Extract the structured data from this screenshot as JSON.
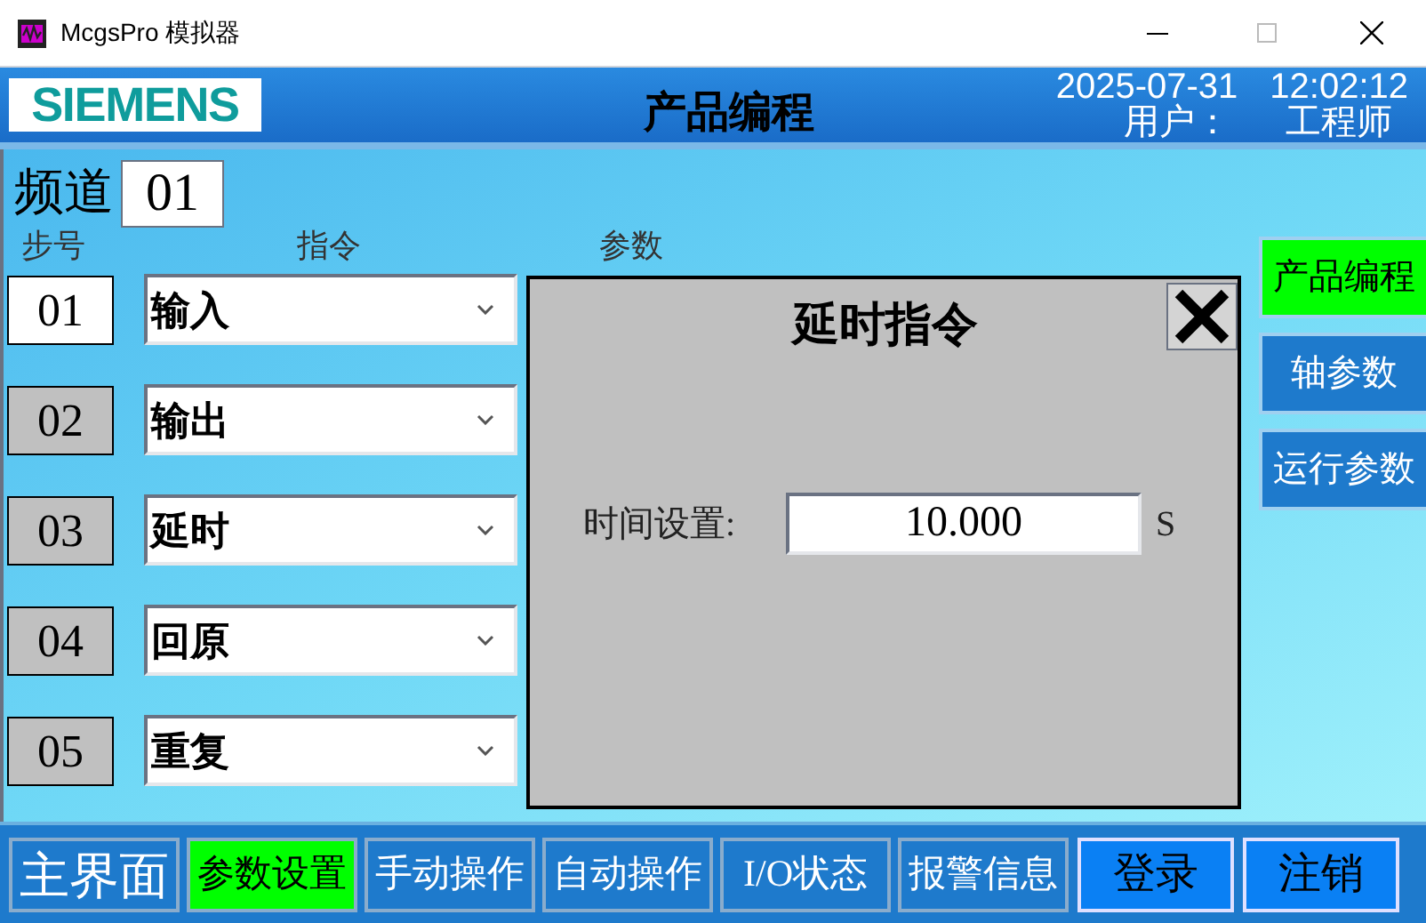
{
  "window": {
    "title": "McgsPro 模拟器"
  },
  "header": {
    "logo": "SIEMENS",
    "title": "产品编程",
    "date": "2025-07-31",
    "time": "12:02:12",
    "user_label": "用户：",
    "user": "工程师"
  },
  "channel": {
    "label": "频道",
    "value": "01"
  },
  "columns": [
    "步号",
    "指令",
    "参数"
  ],
  "steps": [
    {
      "number": "01",
      "command": "输入",
      "selected": true
    },
    {
      "number": "02",
      "command": "输出",
      "selected": false
    },
    {
      "number": "03",
      "command": "延时",
      "selected": false
    },
    {
      "number": "04",
      "command": "回原",
      "selected": false
    },
    {
      "number": "05",
      "command": "重复",
      "selected": false
    }
  ],
  "dialog": {
    "title": "延时指令",
    "field_label": "时间设置:",
    "value": "10.000",
    "unit": "S"
  },
  "side_buttons": [
    {
      "label": "产品编程",
      "selected": true
    },
    {
      "label": "轴参数",
      "selected": false
    },
    {
      "label": "运行参数",
      "selected": false
    }
  ],
  "bottom_nav": [
    {
      "label": "主界面",
      "kind": "nav",
      "selected": false
    },
    {
      "label": "参数设置",
      "kind": "nav",
      "selected": true
    },
    {
      "label": "手动操作",
      "kind": "nav",
      "selected": false
    },
    {
      "label": "自动操作",
      "kind": "nav",
      "selected": false
    },
    {
      "label": "I/O状态",
      "kind": "nav",
      "selected": false
    },
    {
      "label": "报警信息",
      "kind": "nav",
      "selected": false
    },
    {
      "label": "登录",
      "kind": "action",
      "selected": false
    },
    {
      "label": "注销",
      "kind": "action",
      "selected": false
    }
  ]
}
